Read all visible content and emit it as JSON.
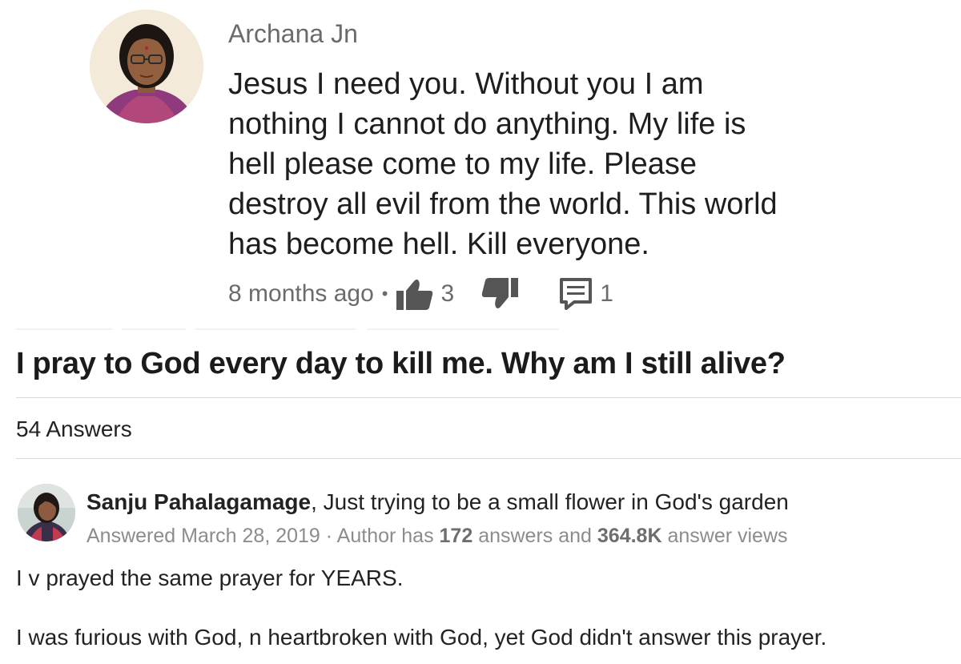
{
  "comment": {
    "author": "Archana Jn",
    "body": "Jesus I need you. Without you I am\nnothing I cannot do anything. My life is\nhell  please come to my life. Please\ndestroy all evil from the world. This world\nhas become hell. Kill everyone.",
    "timestamp": "8 months ago",
    "separator": "•",
    "upvotes": "3",
    "replies": "1",
    "icons": {
      "upvote": "thumbs-up-icon",
      "downvote": "thumbs-down-icon",
      "reply": "comment-icon"
    }
  },
  "question": {
    "title": "I pray to God every day to kill me. Why am I still alive?",
    "answer_count_label": "54 Answers"
  },
  "answer": {
    "author_name": "Sanju Pahalagamage",
    "credential": ", Just trying to be a small flower in God's garden",
    "answered_label": "Answered March 28, 2019 · Author has ",
    "answers_number": "172",
    "answers_mid": " answers and ",
    "views_number": "364.8K",
    "views_tail": " answer views",
    "paragraphs": [
      "I v prayed the same prayer for YEARS.",
      "I was furious with God, n heartbroken with God, yet God didn't answer this prayer."
    ]
  }
}
